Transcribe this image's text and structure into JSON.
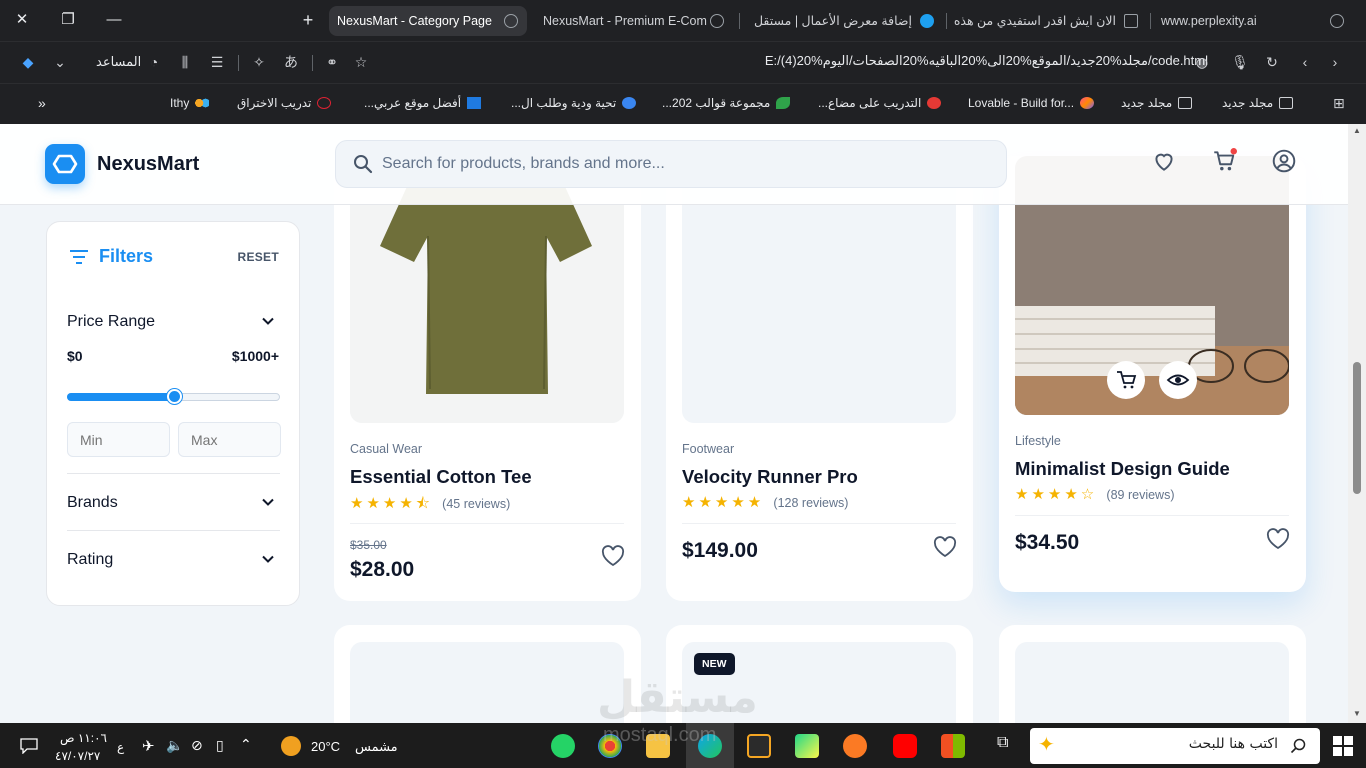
{
  "browser": {
    "tabs": [
      {
        "title": "NexusMart - Category Page",
        "active": true
      },
      {
        "title": "NexusMart - Premium E-Com",
        "active": false
      },
      {
        "title": "إضافة معرض الأعمال | مستقل",
        "active": false
      },
      {
        "title": "الان ايش اقدر استفيدي من هذه",
        "active": false
      },
      {
        "title": "www.perplexity.ai",
        "active": false
      }
    ],
    "url": "E:/(4)20%مجلد%20جديد/الموقع%20الى%20الباقيه%20الصفحات/اليوم/code.html",
    "assistant_label": "المساعد",
    "bookmarks": [
      "مجلد جديد",
      "مجلد جديد",
      "Lovable - Build for...",
      "التدريب على مضاع...",
      "مجموعة قوالب 202...",
      "تحية ودية وطلب ال...",
      "أفضل موقع عربي...",
      "تدريب الاختراق",
      "Ithy"
    ]
  },
  "header": {
    "brand": "NexusMart",
    "search_placeholder": "Search for products, brands and more...",
    "cart_has_dot": true
  },
  "filters": {
    "title": "Filters",
    "reset": "RESET",
    "price_range_label": "Price Range",
    "price_min_label": "$0",
    "price_max_label": "$1000+",
    "slider_value_fraction": 0.5,
    "min_placeholder": "Min",
    "max_placeholder": "Max",
    "brands_label": "Brands",
    "rating_label": "Rating"
  },
  "products": [
    {
      "category": "Casual Wear",
      "name": "Essential Cotton Tee",
      "rating": 4.5,
      "stars": "★★★★⯪",
      "reviews": "(45 reviews)",
      "old_price": "$35.00",
      "price": "$28.00"
    },
    {
      "category": "Footwear",
      "name": "Velocity Runner Pro",
      "rating": 5,
      "stars": "★★★★★",
      "reviews": "(128 reviews)",
      "old_price": "",
      "price": "$149.00"
    },
    {
      "category": "Lifestyle",
      "name": "Minimalist Design Guide",
      "rating": 4.5,
      "stars": "★★★★☆",
      "reviews": "(89 reviews)",
      "old_price": "",
      "price": "$34.50"
    }
  ],
  "second_row": {
    "badge": "NEW"
  },
  "watermark": {
    "text": "مستقل",
    "sub": "mostaql.com"
  },
  "taskbar": {
    "search_placeholder": "اكتب هنا للبحث",
    "weather_temp": "20°C",
    "weather_desc": "مشمس",
    "time": "١١:٠٦ ص",
    "date": "٤٧/٠٧/٢٧",
    "lang": "ع"
  },
  "colors": {
    "accent": "#1a8ef2",
    "star": "#f5b301",
    "dark": "#0f172a"
  }
}
